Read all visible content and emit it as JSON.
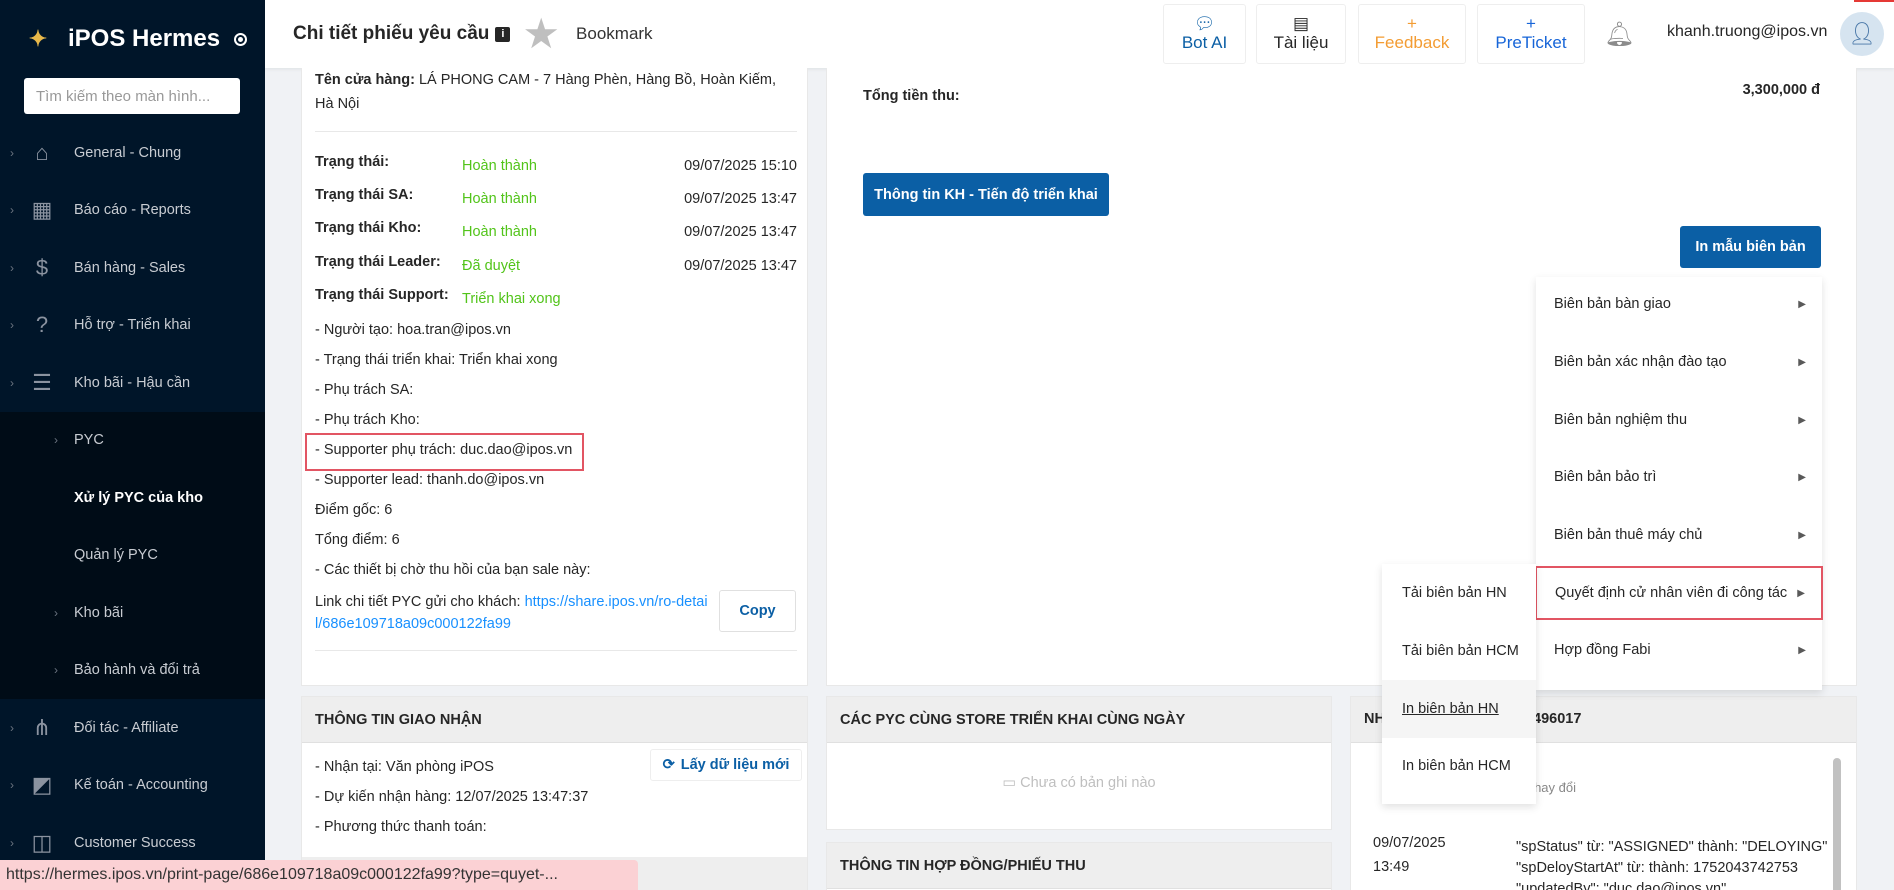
{
  "sidebar": {
    "brand": "iPOS Hermes",
    "search_placeholder": "Tìm kiếm theo màn hình...",
    "items": [
      {
        "label": "General - Chung",
        "icon": "home-icon"
      },
      {
        "label": "Báo cáo - Reports",
        "icon": "chart-icon"
      },
      {
        "label": "Bán hàng - Sales",
        "icon": "dollar-icon"
      },
      {
        "label": "Hỗ trợ - Triển khai",
        "icon": "question-icon"
      },
      {
        "label": "Kho bãi - Hậu cần",
        "icon": "warehouse-icon"
      }
    ],
    "sub_items": [
      {
        "label": "PYC"
      },
      {
        "label": "Xử lý PYC của kho"
      },
      {
        "label": "Quản lý PYC"
      },
      {
        "label": "Kho bãi"
      },
      {
        "label": "Bảo hành và đổi trả"
      }
    ],
    "items_after": [
      {
        "label": "Đối tác - Affiliate",
        "icon": "share-icon"
      },
      {
        "label": "Kế toán - Accounting",
        "icon": "accounting-icon"
      },
      {
        "label": "Customer Success",
        "icon": "customer-icon"
      }
    ]
  },
  "header": {
    "title": "Chi tiết phiếu yêu cầu",
    "bookmark": "Bookmark",
    "bot_ai": "Bot AI",
    "docs": "Tài liệu",
    "feedback": "Feedback",
    "preticket": "PreTicket",
    "user_email": "khanh.truong@ipos.vn",
    "colors": {
      "primary": "#0b5fa5",
      "feedback": "#f39c33",
      "preticket": "#1765d8"
    }
  },
  "detail": {
    "store_label": "Tên cửa hàng:",
    "store_value": "LÁ PHONG CAM - 7 Hàng Phèn, Hàng Bồ, Hoàn Kiếm, Hà Nội",
    "statuses": [
      {
        "label": "Trạng thái:",
        "value": "Hoàn thành",
        "time": "09/07/2025 15:10"
      },
      {
        "label": "Trạng thái SA:",
        "value": "Hoàn thành",
        "time": "09/07/2025 13:47"
      },
      {
        "label": "Trạng thái Kho:",
        "value": "Hoàn thành",
        "time": "09/07/2025 13:47"
      },
      {
        "label": "Trạng thái Leader:",
        "value": "Đã duyệt",
        "time": "09/07/2025 13:47"
      },
      {
        "label": "Trạng thái Support:",
        "value": "Triển khai xong",
        "time": ""
      }
    ],
    "lines": [
      "- Người tạo: hoa.tran@ipos.vn",
      "- Trạng thái triển khai: Triển khai xong",
      "- Phụ trách SA:",
      "- Phụ trách Kho:",
      "- Supporter phụ trách: duc.dao@ipos.vn",
      "- Supporter lead: thanh.do@ipos.vn",
      "Điểm gốc: 6",
      "Tổng điểm: 6",
      "- Các thiết bị chờ thu hồi của bạn sale này:"
    ],
    "link_label": "Link chi tiết PYC gửi cho khách:",
    "link_line1": "https://share.ipos.vn/ro-detai",
    "link_line2": "l/686e109718a09c000122fa99",
    "copy": "Copy"
  },
  "summary": {
    "total_label": "Tổng tiền thu:",
    "total_value": "3,300,000 đ",
    "kh_button": "Thông tin KH - Tiến độ triển khai",
    "print_button": "In mẫu biên bản"
  },
  "print_menu": [
    "Biên bản bàn giao",
    "Biên bản xác nhận đào tạo",
    "Biên bản nghiệm thu",
    "Biên bản bảo trì",
    "Biên bản thuê máy chủ",
    "Quyết định cử nhân viên đi công tác",
    "Hợp đồng Fabi"
  ],
  "print_submenu": [
    "Tải biên bản HN",
    "Tải biên bản HCM",
    "In biên bản HN",
    "In biên bản HCM"
  ],
  "delivery": {
    "title": "THÔNG TIN GIAO NHẬN",
    "refresh": "Lấy dữ liệu mới",
    "lines": [
      "- Nhận tại: Văn phòng iPOS",
      "- Dự kiến nhận hàng: 12/07/2025 13:47:37",
      "- Phương thức thanh toán:"
    ]
  },
  "same_store": {
    "title": "CÁC PYC CÙNG STORE TRIỂN KHAI CÙNG NGÀY",
    "empty": "Chưa có bản ghi nào"
  },
  "contract": {
    "title": "THÔNG TIN HỢP ĐỒNG/PHIẾU THU"
  },
  "log": {
    "title_left": "NH",
    "title_right": "496017",
    "subhead": "i tiết thay đổi",
    "date": "09/07/2025",
    "time": "13:49",
    "changes": [
      "\"spStatus\" từ: \"ASSIGNED\" thành: \"DELOYING\"",
      "\"spDeloyStartAt\" từ: thành: 1752043742753",
      "\"updatedBy\": \"duc.dao@ipos.vn\""
    ]
  },
  "status_bar_url": "https://hermes.ipos.vn/print-page/686e109718a09c000122fa99?type=quyet-..."
}
